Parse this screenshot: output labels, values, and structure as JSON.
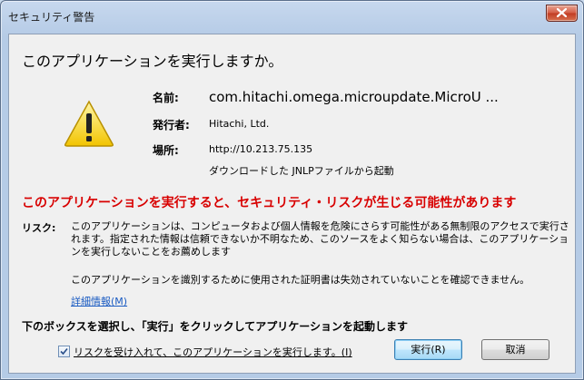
{
  "window": {
    "title": "セキュリティ警告"
  },
  "dialog": {
    "heading": "このアプリケーションを実行しますか。",
    "name_label": "名前:",
    "name_value": "com.hitachi.omega.microupdate.MicroU ...",
    "publisher_label": "発行者:",
    "publisher_value": "Hitachi, Ltd.",
    "location_label": "場所:",
    "location_value": "http://10.213.75.135",
    "location_sub": "ダウンロードした JNLPファイルから起動",
    "danger_text": "このアプリケーションを実行すると、セキュリティ・リスクが生じる可能性があります",
    "risk_label": "リスク:",
    "risk_text": "このアプリケーションは、コンピュータおよび個人情報を危険にさらす可能性がある無制限のアクセスで実行されます。指定された情報は信頼できないか不明なため、このソースをよく知らない場合は、このアプリケーションを実行しないことをお薦めします",
    "cert_text": "このアプリケーションを識別するために使用された証明書は失効されていないことを確認できません。",
    "more_info_link": "詳細情報(M)",
    "bottom_heading": "下のボックスを選択し、「実行」をクリックしてアプリケーションを起動します",
    "checkbox_label": "リスクを受け入れて、このアプリケーションを実行します。(I)",
    "checkbox_checked": true,
    "run_button": "実行(R)",
    "cancel_button": "取消"
  },
  "icons": {
    "warning": "warning-triangle-icon",
    "close": "close-icon",
    "check": "checkmark-icon"
  },
  "colors": {
    "danger": "#d80000",
    "link": "#1a5bc2",
    "close_button": "#c13b22"
  }
}
